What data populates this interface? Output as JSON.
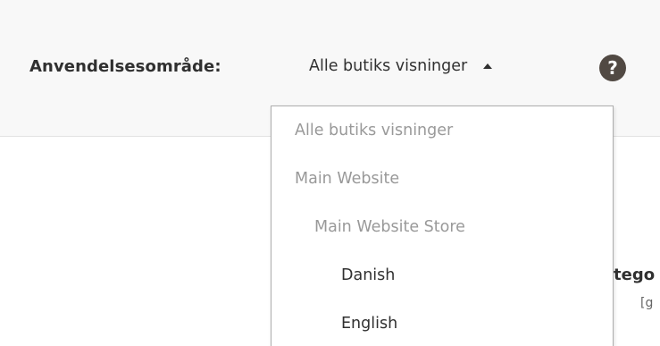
{
  "header": {
    "scope_label": "Anvendelsesområde:",
    "scope_value": "Alle butiks visninger",
    "help_glyph": "?",
    "icons": [
      "caret-up-icon",
      "help-icon"
    ]
  },
  "dropdown": {
    "items": [
      {
        "label": "Alle butiks visninger",
        "state": "disabled"
      },
      {
        "label": "Main Website",
        "state": "disabled"
      },
      {
        "label": "Main Website Store",
        "state": "disabled"
      },
      {
        "label": "Danish",
        "state": "enabled"
      },
      {
        "label": "English",
        "state": "enabled"
      }
    ]
  },
  "background": {
    "partial_heading": "tego",
    "partial_note": "[g"
  },
  "colors": {
    "header_bg": "#f8f8f8",
    "text": "#303030",
    "disabled_text": "#999999",
    "help_icon_bg": "#514943"
  }
}
